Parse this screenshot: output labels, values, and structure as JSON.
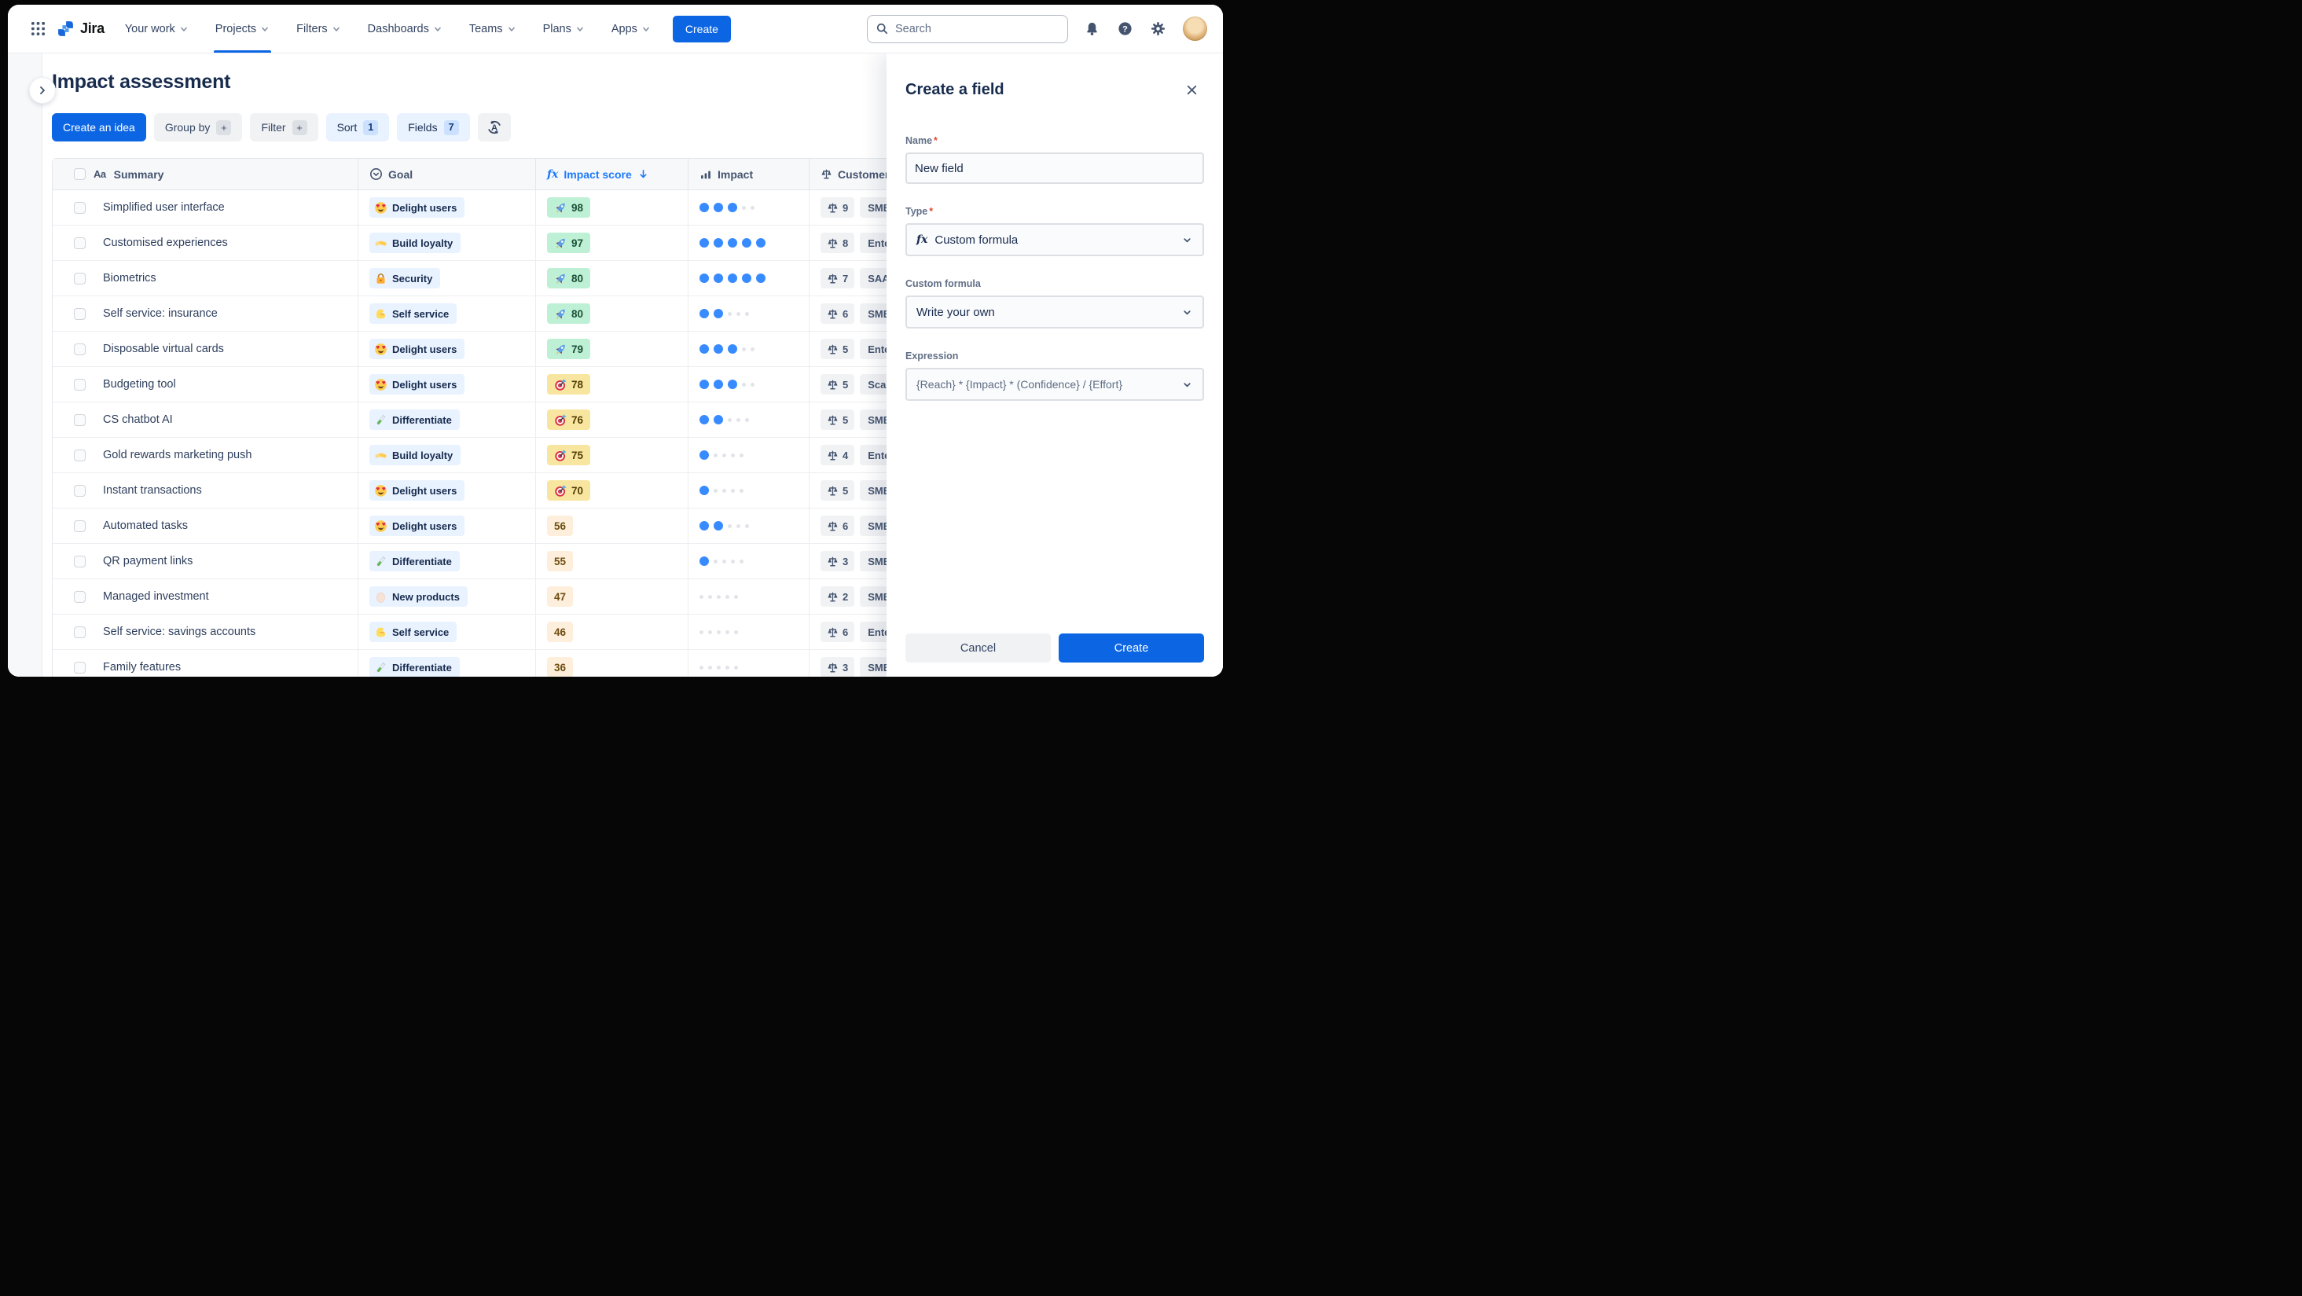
{
  "nav": {
    "brand": "Jira",
    "items": [
      {
        "label": "Your work",
        "active": false
      },
      {
        "label": "Projects",
        "active": true
      },
      {
        "label": "Filters",
        "active": false
      },
      {
        "label": "Dashboards",
        "active": false
      },
      {
        "label": "Teams",
        "active": false
      },
      {
        "label": "Plans",
        "active": false
      },
      {
        "label": "Apps",
        "active": false
      }
    ],
    "create_button": "Create",
    "search_placeholder": "Search",
    "icons": [
      "app-switcher-grid",
      "bell",
      "help-circle",
      "gear",
      "avatar"
    ]
  },
  "sidebar": {
    "expand_icon": "chevron-right"
  },
  "page": {
    "title": "Impact assessment"
  },
  "toolbar": {
    "create_idea": "Create an idea",
    "group_by": "Group by",
    "group_by_plus": "+",
    "filter": "Filter",
    "filter_plus": "+",
    "sort": "Sort",
    "sort_count": "1",
    "fields": "Fields",
    "fields_count": "7",
    "translate_icon": "a-with-arrows"
  },
  "table": {
    "headers": {
      "summary": "Summary",
      "summary_icon": "Aa",
      "goal": "Goal",
      "impact_score": "Impact score",
      "impact_score_icon": "fx",
      "impact": "Impact",
      "customer": "Customer"
    },
    "impact_scale_max": 5,
    "rows": [
      {
        "summary": "Simplified user interface",
        "goal": "Delight users",
        "goal_icon": "heart-eyes",
        "score": "98",
        "score_tone": "green",
        "score_icon": "rocket",
        "impact": 3,
        "weight": "9",
        "customer": "SMB"
      },
      {
        "summary": "Customised experiences",
        "goal": "Build loyalty",
        "goal_icon": "handshake",
        "score": "97",
        "score_tone": "green",
        "score_icon": "rocket",
        "impact": 5,
        "weight": "8",
        "customer": "Enter"
      },
      {
        "summary": "Biometrics",
        "goal": "Security",
        "goal_icon": "lock",
        "score": "80",
        "score_tone": "green",
        "score_icon": "rocket",
        "impact": 5,
        "weight": "7",
        "customer": "SAAS"
      },
      {
        "summary": "Self service: insurance",
        "goal": "Self service",
        "goal_icon": "biceps",
        "score": "80",
        "score_tone": "green",
        "score_icon": "rocket",
        "impact": 2,
        "weight": "6",
        "customer": "SMB"
      },
      {
        "summary": "Disposable virtual cards",
        "goal": "Delight users",
        "goal_icon": "heart-eyes",
        "score": "79",
        "score_tone": "green",
        "score_icon": "rocket",
        "impact": 3,
        "weight": "5",
        "customer": "Enter"
      },
      {
        "summary": "Budgeting tool",
        "goal": "Delight users",
        "goal_icon": "heart-eyes",
        "score": "78",
        "score_tone": "yellow",
        "score_icon": "target",
        "impact": 3,
        "weight": "5",
        "customer": "Scale"
      },
      {
        "summary": "CS chatbot AI",
        "goal": "Differentiate",
        "goal_icon": "test-tube",
        "score": "76",
        "score_tone": "yellow",
        "score_icon": "target",
        "impact": 2,
        "weight": "5",
        "customer": "SMB"
      },
      {
        "summary": "Gold rewards marketing push",
        "goal": "Build loyalty",
        "goal_icon": "handshake",
        "score": "75",
        "score_tone": "yellow",
        "score_icon": "target",
        "impact": 1,
        "weight": "4",
        "customer": "Enter"
      },
      {
        "summary": "Instant transactions",
        "goal": "Delight users",
        "goal_icon": "heart-eyes",
        "score": "70",
        "score_tone": "yellow",
        "score_icon": "target",
        "impact": 1,
        "weight": "5",
        "customer": "SMB"
      },
      {
        "summary": "Automated tasks",
        "goal": "Delight users",
        "goal_icon": "heart-eyes",
        "score": "56",
        "score_tone": "plain",
        "score_icon": "none",
        "impact": 2,
        "weight": "6",
        "customer": "SMB"
      },
      {
        "summary": "QR payment links",
        "goal": "Differentiate",
        "goal_icon": "test-tube",
        "score": "55",
        "score_tone": "plain",
        "score_icon": "none",
        "impact": 1,
        "weight": "3",
        "customer": "SMB"
      },
      {
        "summary": "Managed investment",
        "goal": "New products",
        "goal_icon": "egg",
        "score": "47",
        "score_tone": "plain",
        "score_icon": "none",
        "impact": 0,
        "weight": "2",
        "customer": "SMB"
      },
      {
        "summary": "Self service: savings accounts",
        "goal": "Self service",
        "goal_icon": "biceps",
        "score": "46",
        "score_tone": "plain",
        "score_icon": "none",
        "impact": 0,
        "weight": "6",
        "customer": "Enter"
      },
      {
        "summary": "Family features",
        "goal": "Differentiate",
        "goal_icon": "test-tube",
        "score": "36",
        "score_tone": "plain",
        "score_icon": "none",
        "impact": 0,
        "weight": "3",
        "customer": "SMB"
      }
    ]
  },
  "panel": {
    "title": "Create a field",
    "required_marker": "*",
    "name_label": "Name",
    "name_value": "New field",
    "type_label": "Type",
    "type_value": "Custom formula",
    "type_icon": "fx",
    "custom_formula_label": "Custom formula",
    "custom_formula_value": "Write your own",
    "expression_label": "Expression",
    "expression_value": "{Reach} * {Impact} * (Confidence} / {Effort}",
    "cancel_button": "Cancel",
    "create_button": "Create"
  },
  "colors": {
    "primary_blue": "#0C66E4",
    "link_blue": "#1D7AFC",
    "dot_blue": "#388BFF",
    "green_badge_bg": "#BDF0D4",
    "green_badge_text": "#1C4F38",
    "yellow_badge_bg": "#F8E6A0",
    "yellow_badge_text": "#533F04",
    "plain_badge_bg": "#FDEFDB",
    "plain_badge_text": "#6E4D12",
    "goal_chip_bg": "#E9F2FF",
    "gray_chip_bg": "#F1F2F4",
    "text_navy": "#172B4D"
  }
}
